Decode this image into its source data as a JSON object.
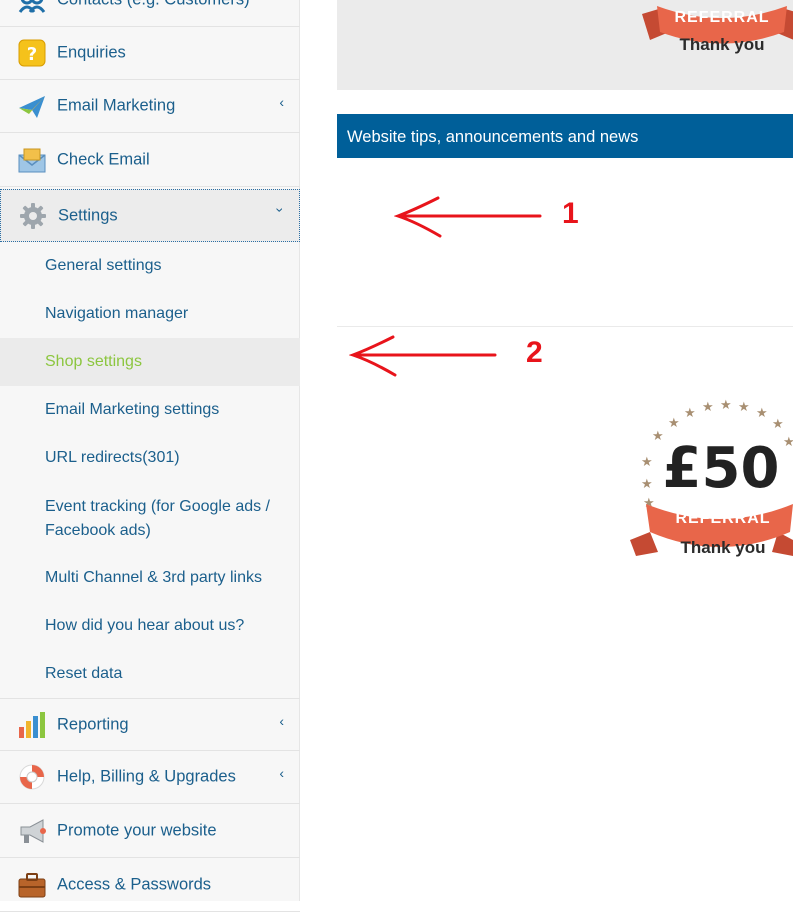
{
  "sidebar": {
    "items": [
      {
        "label": "Contacts (e.g. Customers)",
        "icon": "contacts-icon"
      },
      {
        "label": "Enquiries",
        "icon": "question-icon"
      },
      {
        "label": "Email Marketing",
        "icon": "paper-plane-icon",
        "chevron": "‹"
      },
      {
        "label": "Check Email",
        "icon": "envelope-icon"
      },
      {
        "label": "Settings",
        "icon": "gear-icon",
        "chevron": "›"
      },
      {
        "label": "Reporting",
        "icon": "bar-chart-icon",
        "chevron": "‹"
      },
      {
        "label": "Help, Billing & Upgrades",
        "icon": "lifebuoy-icon",
        "chevron": "‹"
      },
      {
        "label": "Promote your website",
        "icon": "megaphone-icon"
      },
      {
        "label": "Access & Passwords",
        "icon": "briefcase-icon"
      }
    ],
    "settings_sub": [
      "General settings",
      "Navigation manager",
      "Shop settings",
      "Email Marketing settings",
      "URL redirects(301)",
      "Event tracking (for Google ads / Facebook ads)",
      "Multi Channel & 3rd party links",
      "How did you hear about us?",
      "Reset data"
    ]
  },
  "main": {
    "news_header": "Website tips, announcements and news",
    "badge_top": {
      "ribbon": "REFERRAL",
      "caption": "Thank you"
    },
    "badge": {
      "amount": "£50",
      "ribbon": "REFERRAL",
      "caption": "Thank you"
    }
  },
  "annotations": {
    "one": "1",
    "two": "2"
  },
  "colors": {
    "link": "#1b5f8c",
    "header": "#005f99",
    "selected": "#8cc63f",
    "annotation": "#e8141b",
    "ribbon": "#e8664a"
  }
}
